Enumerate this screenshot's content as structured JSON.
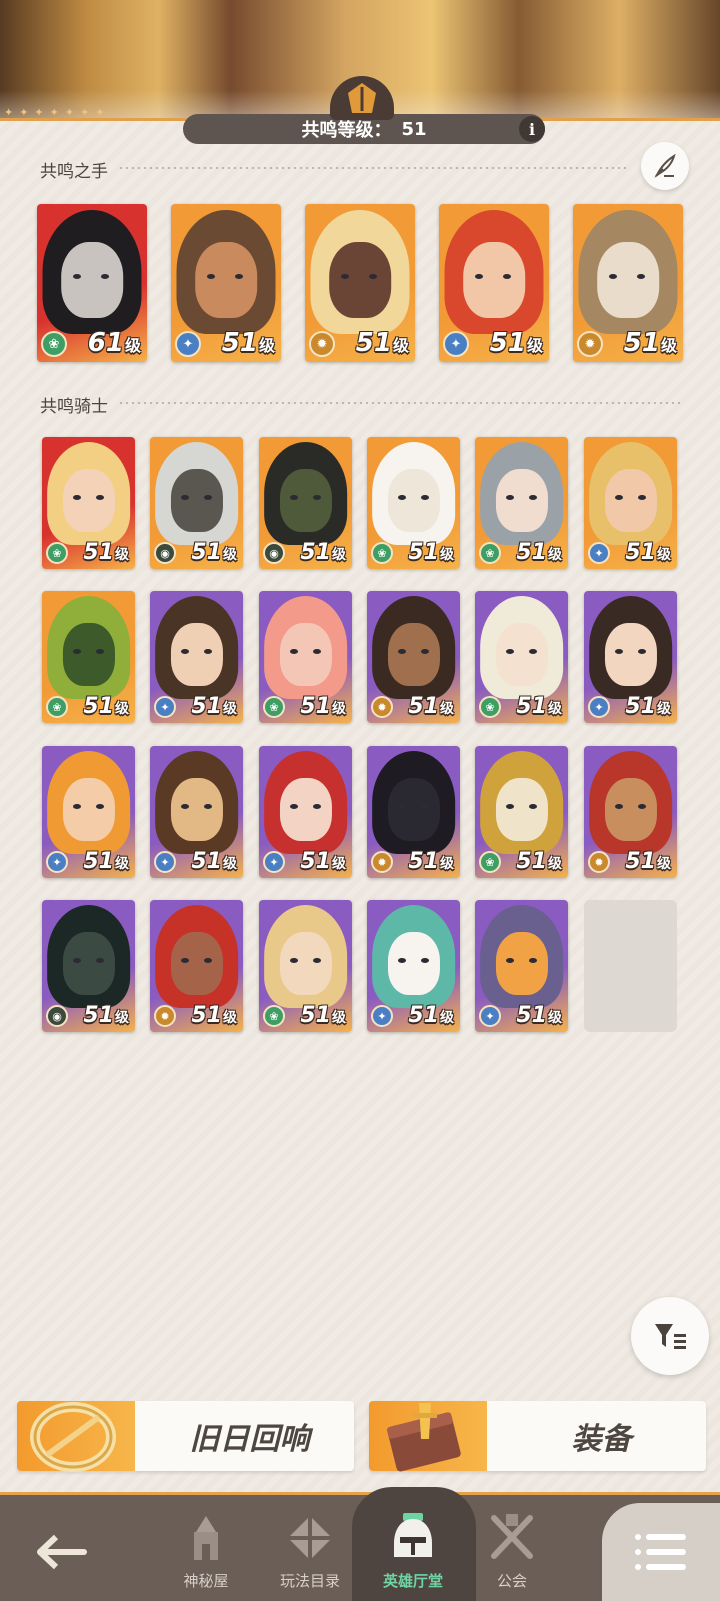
{
  "header": {
    "level_label": "共鸣等级：",
    "level_value": "51",
    "info_glyph": "i"
  },
  "sections": {
    "hands_title": "共鸣之手",
    "knights_title": "共鸣骑士"
  },
  "level_unit": "级",
  "hands": [
    {
      "level": "61",
      "faction": "wilder",
      "bg": "#d8322f",
      "skin": "#c9c3c0",
      "hair": "#1f1d20"
    },
    {
      "level": "51",
      "faction": "lightbearer",
      "bg": "#f19a36",
      "skin": "#c98a5e",
      "hair": "#6a4a32"
    },
    {
      "level": "51",
      "faction": "mauler",
      "bg": "#f19a36",
      "skin": "#6a4536",
      "hair": "#f2d79a"
    },
    {
      "level": "51",
      "faction": "lightbearer",
      "bg": "#f19a36",
      "skin": "#f2c7a8",
      "hair": "#d9482d"
    },
    {
      "level": "51",
      "faction": "mauler",
      "bg": "#f19a36",
      "skin": "#e9dccb",
      "hair": "#a58862"
    }
  ],
  "knights": [
    {
      "level": "51",
      "faction": "wilder",
      "bg": "#d8322f",
      "skin": "#f4d2b8",
      "hair": "#f2cf83"
    },
    {
      "level": "51",
      "faction": "graveborn",
      "bg": "#f19a36",
      "skin": "#59574f",
      "hair": "#d6d6d2"
    },
    {
      "level": "51",
      "faction": "graveborn",
      "bg": "#f19a36",
      "skin": "#4e5a3a",
      "hair": "#2a2a26"
    },
    {
      "level": "51",
      "faction": "wilder",
      "bg": "#f19a36",
      "skin": "#efe6da",
      "hair": "#f7f3ee"
    },
    {
      "level": "51",
      "faction": "wilder",
      "bg": "#f19a36",
      "skin": "#f1dcd0",
      "hair": "#9aa2a8"
    },
    {
      "level": "51",
      "faction": "lightbearer",
      "bg": "#f19a36",
      "skin": "#f1c9a8",
      "hair": "#e8c06a"
    },
    {
      "level": "51",
      "faction": "wilder",
      "bg": "#f19a36",
      "skin": "#3c5a2a",
      "hair": "#8fae3a"
    },
    {
      "level": "51",
      "faction": "lightbearer",
      "bg": "#8a5bc0",
      "skin": "#f0d0b4",
      "hair": "#4a3426"
    },
    {
      "level": "51",
      "faction": "wilder",
      "bg": "#8a5bc0",
      "skin": "#f4c6b6",
      "hair": "#f39a8a"
    },
    {
      "level": "51",
      "faction": "mauler",
      "bg": "#8a5bc0",
      "skin": "#a0704e",
      "hair": "#3a2a22"
    },
    {
      "level": "51",
      "faction": "wilder",
      "bg": "#8a5bc0",
      "skin": "#f4e1cf",
      "hair": "#f0ead8"
    },
    {
      "level": "51",
      "faction": "lightbearer",
      "bg": "#8a5bc0",
      "skin": "#f2d6c0",
      "hair": "#3a2a24"
    },
    {
      "level": "51",
      "faction": "lightbearer",
      "bg": "#8a5bc0",
      "skin": "#f4cda8",
      "hair": "#f09a34"
    },
    {
      "level": "51",
      "faction": "lightbearer",
      "bg": "#8a5bc0",
      "skin": "#e2b884",
      "hair": "#5a3a24"
    },
    {
      "level": "51",
      "faction": "lightbearer",
      "bg": "#8a5bc0",
      "skin": "#f3d3c4",
      "hair": "#c6302e"
    },
    {
      "level": "51",
      "faction": "mauler",
      "bg": "#8a5bc0",
      "skin": "#2a2830",
      "hair": "#1e1c22"
    },
    {
      "level": "51",
      "faction": "wilder",
      "bg": "#8a5bc0",
      "skin": "#efe4c9",
      "hair": "#cfa23c"
    },
    {
      "level": "51",
      "faction": "mauler",
      "bg": "#8a5bc0",
      "skin": "#c98e5e",
      "hair": "#b8362a"
    },
    {
      "level": "51",
      "faction": "graveborn",
      "bg": "#8a5bc0",
      "skin": "#3c4a44",
      "hair": "#1c2826"
    },
    {
      "level": "51",
      "faction": "mauler",
      "bg": "#8a5bc0",
      "skin": "#a5644a",
      "hair": "#c73228"
    },
    {
      "level": "51",
      "faction": "wilder",
      "bg": "#8a5bc0",
      "skin": "#f2d8bc",
      "hair": "#e8c98a"
    },
    {
      "level": "51",
      "faction": "lightbearer",
      "bg": "#8a5bc0",
      "skin": "#f7f3ef",
      "hair": "#5eb8a8"
    },
    {
      "level": "51",
      "faction": "lightbearer",
      "bg": "#8a5bc0",
      "skin": "#f1a244",
      "hair": "#6a6090"
    }
  ],
  "faction_colors": {
    "wilder": "#3f9e63",
    "lightbearer": "#4a7fc3",
    "mauler": "#c9892c",
    "graveborn": "#3b4a3a"
  },
  "icons": {
    "edit": "quill-icon",
    "filter": "filter-sort-icon",
    "back": "back-arrow-icon",
    "menu": "list-menu-icon"
  },
  "actions": {
    "echoes_label": "旧日回响",
    "equipment_label": "装备"
  },
  "nav": {
    "mystic_house": "神秘屋",
    "gameplay": "玩法目录",
    "hero_hall": "英雄厅堂",
    "guild": "公会"
  }
}
